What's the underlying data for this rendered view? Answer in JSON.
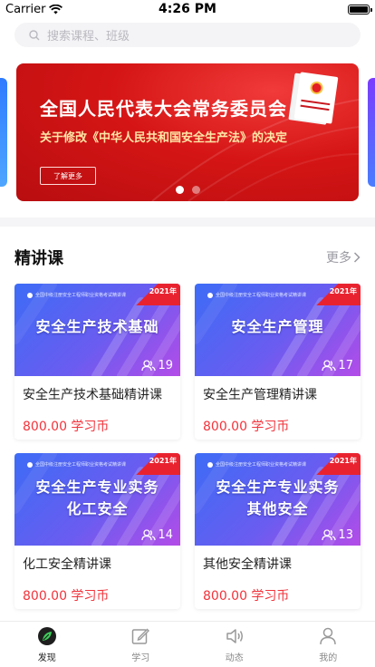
{
  "status": {
    "carrier": "Carrier",
    "time": "4:26 PM"
  },
  "search": {
    "placeholder": "搜索课程、班级"
  },
  "banner": {
    "title": "全国人民代表大会常务委员会",
    "subtitle": "关于修改《中华人民共和国安全生产法》的决定",
    "button": "了解更多"
  },
  "section": {
    "title": "精讲课",
    "more": "更多"
  },
  "courses": [
    {
      "thumb_title": [
        "安全生产技术基础"
      ],
      "year": "2021年",
      "count": "19",
      "name": "安全生产技术基础精讲课",
      "price": "800.00 学习币"
    },
    {
      "thumb_title": [
        "安全生产管理"
      ],
      "year": "2021年",
      "count": "17",
      "name": "安全生产管理精讲课",
      "price": "800.00 学习币"
    },
    {
      "thumb_title": [
        "安全生产专业实务",
        "化工安全"
      ],
      "year": "2021年",
      "count": "14",
      "name": "化工安全精讲课",
      "price": "800.00 学习币"
    },
    {
      "thumb_title": [
        "安全生产专业实务",
        "其他安全"
      ],
      "year": "2021年",
      "count": "13",
      "name": "其他安全精讲课",
      "price": "800.00 学习币"
    }
  ],
  "thumb_header": "全国中级注册安全工程师职业资格考试精讲课",
  "tabs": [
    {
      "label": "发现",
      "icon": "compass-leaf-icon",
      "active": true
    },
    {
      "label": "学习",
      "icon": "edit-note-icon",
      "active": false
    },
    {
      "label": "动态",
      "icon": "speaker-icon",
      "active": false
    },
    {
      "label": "我的",
      "icon": "person-icon",
      "active": false
    }
  ],
  "colors": {
    "accent_red": "#f2333b",
    "banner_red": "#d51515",
    "active_tab_green": "#27a84a"
  }
}
